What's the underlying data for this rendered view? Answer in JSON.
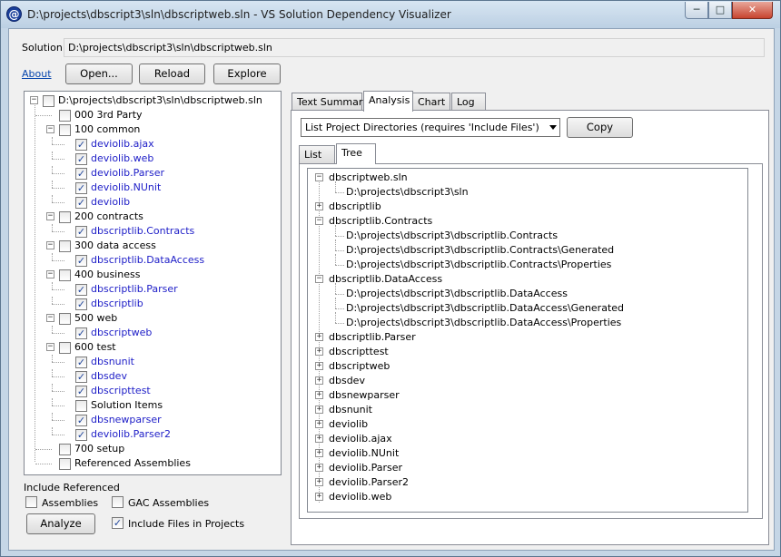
{
  "window": {
    "title": "D:\\projects\\dbscript3\\sln\\dbscriptweb.sln - VS Solution Dependency Visualizer",
    "minimize": "─",
    "maximize": "□",
    "close": "✕"
  },
  "solution": {
    "label": "Solution",
    "path": "D:\\projects\\dbscript3\\sln\\dbscriptweb.sln"
  },
  "toolbar": {
    "about": "About",
    "open": "Open...",
    "reload": "Reload",
    "explore": "Explore"
  },
  "project_tree": {
    "root": "D:\\projects\\dbscript3\\sln\\dbscriptweb.sln",
    "groups": [
      {
        "name": "000 3rd Party",
        "children": []
      },
      {
        "name": "100 common",
        "children": [
          "deviolib.ajax",
          "deviolib.web",
          "deviolib.Parser",
          "deviolib.NUnit",
          "deviolib"
        ]
      },
      {
        "name": "200 contracts",
        "children": [
          "dbscriptlib.Contracts"
        ]
      },
      {
        "name": "300 data access",
        "children": [
          "dbscriptlib.DataAccess"
        ]
      },
      {
        "name": "400 business",
        "children": [
          "dbscriptlib.Parser",
          "dbscriptlib"
        ]
      },
      {
        "name": "500 web",
        "children": [
          "dbscriptweb"
        ]
      },
      {
        "name": "600 test",
        "children": [
          "dbsnunit",
          "dbsdev",
          "dbscripttest",
          "Solution Items",
          "dbsnewparser",
          "deviolib.Parser2"
        ]
      },
      {
        "name": "700 setup",
        "children": []
      },
      {
        "name": "Referenced Assemblies",
        "children": []
      }
    ]
  },
  "include_referenced": {
    "heading": "Include Referenced",
    "assemblies": "Assemblies",
    "gac": "GAC Assemblies",
    "analyze": "Analyze",
    "include_files": "Include Files in Projects",
    "check_mark": "✓"
  },
  "tabs": [
    "Text Summary",
    "Analysis",
    "Chart",
    "Log"
  ],
  "analysis": {
    "dropdown_value": "List Project Directories (requires 'Include Files')",
    "copy": "Copy",
    "subtabs": [
      "List",
      "Tree"
    ],
    "tree": [
      {
        "name": "dbscriptweb.sln",
        "expanded": true,
        "children": [
          "D:\\projects\\dbscript3\\sln"
        ]
      },
      {
        "name": "dbscriptlib",
        "expanded": false,
        "children": []
      },
      {
        "name": "dbscriptlib.Contracts",
        "expanded": true,
        "children": [
          "D:\\projects\\dbscript3\\dbscriptlib.Contracts",
          "D:\\projects\\dbscript3\\dbscriptlib.Contracts\\Generated",
          "D:\\projects\\dbscript3\\dbscriptlib.Contracts\\Properties"
        ]
      },
      {
        "name": "dbscriptlib.DataAccess",
        "expanded": true,
        "children": [
          "D:\\projects\\dbscript3\\dbscriptlib.DataAccess",
          "D:\\projects\\dbscript3\\dbscriptlib.DataAccess\\Generated",
          "D:\\projects\\dbscript3\\dbscriptlib.DataAccess\\Properties"
        ]
      },
      {
        "name": "dbscriptlib.Parser",
        "expanded": false,
        "children": []
      },
      {
        "name": "dbscripttest",
        "expanded": false,
        "children": []
      },
      {
        "name": "dbscriptweb",
        "expanded": false,
        "children": []
      },
      {
        "name": "dbsdev",
        "expanded": false,
        "children": []
      },
      {
        "name": "dbsnewparser",
        "expanded": false,
        "children": []
      },
      {
        "name": "dbsnunit",
        "expanded": false,
        "children": []
      },
      {
        "name": "deviolib",
        "expanded": false,
        "children": []
      },
      {
        "name": "deviolib.ajax",
        "expanded": false,
        "children": []
      },
      {
        "name": "deviolib.NUnit",
        "expanded": false,
        "children": []
      },
      {
        "name": "deviolib.Parser",
        "expanded": false,
        "children": []
      },
      {
        "name": "deviolib.Parser2",
        "expanded": false,
        "children": []
      },
      {
        "name": "deviolib.web",
        "expanded": false,
        "children": []
      }
    ]
  }
}
